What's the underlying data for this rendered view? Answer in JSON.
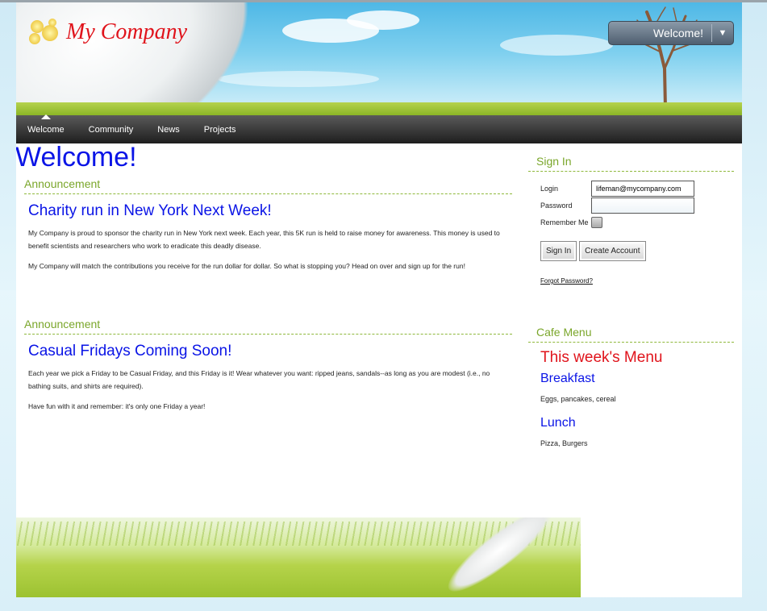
{
  "header": {
    "company_name": "My Company",
    "welcome_button_label": "Welcome!",
    "welcome_button_arrow": "▼"
  },
  "nav": {
    "items": [
      {
        "label": "Welcome",
        "active": true
      },
      {
        "label": "Community",
        "active": false
      },
      {
        "label": "News",
        "active": false
      },
      {
        "label": "Projects",
        "active": false
      }
    ]
  },
  "main": {
    "page_title": "Welcome!",
    "announcements": [
      {
        "heading": "Announcement",
        "title": "Charity run in New York Next Week!",
        "paragraphs": [
          "My Company is proud to sponsor the charity run in New York next week. Each year, this 5K run is held to raise money for awareness. This money is used to benefit scientists and researchers who work to eradicate this deadly disease.",
          "My Company will match the contributions you receive for the run dollar for dollar. So what is stopping you? Head on over and sign up for the run!"
        ]
      },
      {
        "heading": "Announcement",
        "title": "Casual Fridays Coming Soon!",
        "paragraphs": [
          "Each year we pick a Friday to be Casual Friday, and this Friday is it! Wear whatever you want: ripped jeans, sandals--as long as you are modest (i.e., no bathing suits, and shirts are required).",
          "Have fun with it and remember: it's only one Friday a year!"
        ]
      }
    ]
  },
  "sidebar": {
    "sign_in": {
      "heading": "Sign In",
      "login_label": "Login",
      "login_value": "lifeman@mycompany.com",
      "password_label": "Password",
      "password_value": "",
      "remember_label": "Remember Me",
      "remember_checked": false,
      "sign_in_button": "Sign In",
      "create_account_button": "Create Account",
      "forgot_link": "Forgot Password?"
    },
    "cafe": {
      "heading": "Cafe Menu",
      "menu_title": "This week's Menu",
      "breakfast_label": "Breakfast",
      "breakfast_items": "Eggs, pancakes, cereal",
      "lunch_label": "Lunch",
      "lunch_items": "Pizza, Burgers"
    }
  },
  "colors": {
    "title_blue": "#0a14e6",
    "logo_red": "#e0141c",
    "section_green": "#7aa62a",
    "nav_dark": "#1e1e1e"
  }
}
